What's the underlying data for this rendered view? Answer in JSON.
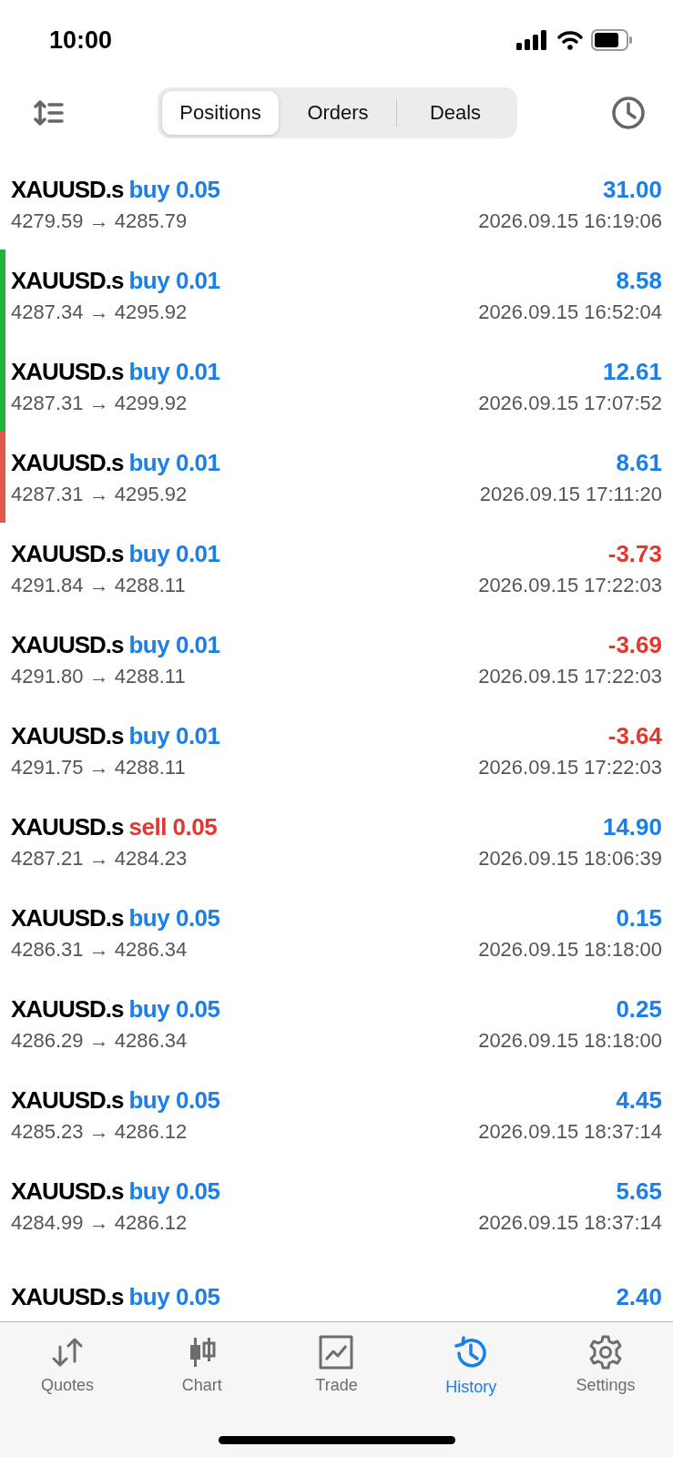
{
  "status_bar": {
    "time": "10:00"
  },
  "toolbar": {
    "tabs": [
      {
        "label": "Positions",
        "selected": true
      },
      {
        "label": "Orders",
        "selected": false
      },
      {
        "label": "Deals",
        "selected": false
      }
    ]
  },
  "deals": [
    {
      "symbol": "XAUUSD.s",
      "kind": "buy",
      "trade": "buy 0.05",
      "profit": "31.00",
      "loss": false,
      "prices": "4279.59 → 4285.79",
      "time": "2026.09.15 16:19:06"
    },
    {
      "symbol": "XAUUSD.s",
      "kind": "buy",
      "trade": "buy 0.01",
      "profit": "8.58",
      "loss": false,
      "prices": "4287.34 → 4295.92",
      "time": "2026.09.15 16:52:04",
      "color": "#1fb33c"
    },
    {
      "symbol": "XAUUSD.s",
      "kind": "buy",
      "trade": "buy 0.01",
      "profit": "12.61",
      "loss": false,
      "prices": "4287.31 → 4299.92",
      "time": "2026.09.15 17:07:52",
      "color": "#1fb33c"
    },
    {
      "symbol": "XAUUSD.s",
      "kind": "buy",
      "trade": "buy 0.01",
      "profit": "8.61",
      "loss": false,
      "prices": "4287.31 → 4295.92",
      "time": "2026.09.15 17:11:20",
      "color": "#e05a4c"
    },
    {
      "symbol": "XAUUSD.s",
      "kind": "buy",
      "trade": "buy 0.01",
      "profit": "-3.73",
      "loss": true,
      "prices": "4291.84 → 4288.11",
      "time": "2026.09.15 17:22:03"
    },
    {
      "symbol": "XAUUSD.s",
      "kind": "buy",
      "trade": "buy 0.01",
      "profit": "-3.69",
      "loss": true,
      "prices": "4291.80 → 4288.11",
      "time": "2026.09.15 17:22:03"
    },
    {
      "symbol": "XAUUSD.s",
      "kind": "buy",
      "trade": "buy 0.01",
      "profit": "-3.64",
      "loss": true,
      "prices": "4291.75 → 4288.11",
      "time": "2026.09.15 17:22:03"
    },
    {
      "symbol": "XAUUSD.s",
      "kind": "sell",
      "trade": "sell 0.05",
      "profit": "14.90",
      "loss": false,
      "prices": "4287.21 → 4284.23",
      "time": "2026.09.15 18:06:39"
    },
    {
      "symbol": "XAUUSD.s",
      "kind": "buy",
      "trade": "buy 0.05",
      "profit": "0.15",
      "loss": false,
      "prices": "4286.31 → 4286.34",
      "time": "2026.09.15 18:18:00"
    },
    {
      "symbol": "XAUUSD.s",
      "kind": "buy",
      "trade": "buy 0.05",
      "profit": "0.25",
      "loss": false,
      "prices": "4286.29 → 4286.34",
      "time": "2026.09.15 18:18:00"
    },
    {
      "symbol": "XAUUSD.s",
      "kind": "buy",
      "trade": "buy 0.05",
      "profit": "4.45",
      "loss": false,
      "prices": "4285.23 → 4286.12",
      "time": "2026.09.15 18:37:14"
    },
    {
      "symbol": "XAUUSD.s",
      "kind": "buy",
      "trade": "buy 0.05",
      "profit": "5.65",
      "loss": false,
      "prices": "4284.99 → 4286.12",
      "time": "2026.09.15 18:37:14"
    },
    {
      "symbol": "XAUUSD.s",
      "kind": "buy",
      "trade": "buy 0.05",
      "profit": "2.40",
      "loss": false
    }
  ],
  "nav": [
    {
      "label": "Quotes",
      "selected": false
    },
    {
      "label": "Chart",
      "selected": false
    },
    {
      "label": "Trade",
      "selected": false
    },
    {
      "label": "History",
      "selected": true
    },
    {
      "label": "Settings",
      "selected": false
    }
  ]
}
